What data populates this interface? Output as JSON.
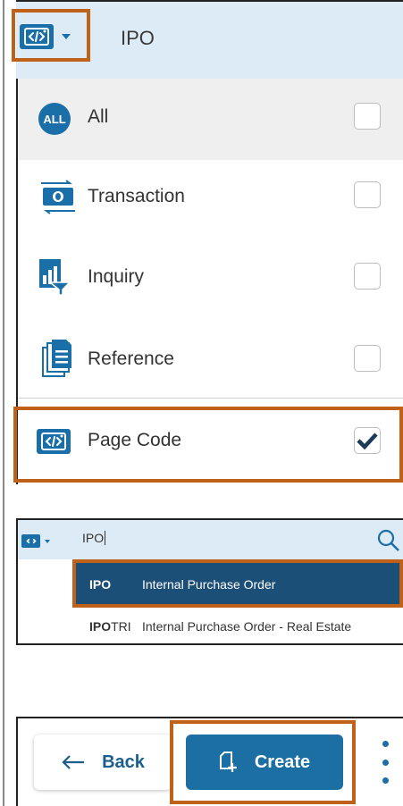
{
  "filter_panel": {
    "title": "IPO",
    "items": [
      {
        "label": "All",
        "checked": false
      },
      {
        "label": "Transaction",
        "checked": false
      },
      {
        "label": "Inquiry",
        "checked": false
      },
      {
        "label": "Reference",
        "checked": false
      },
      {
        "label": "Page Code",
        "checked": true
      }
    ],
    "all_badge_text": "ALL"
  },
  "search_panel": {
    "input_value": "IPO",
    "results": [
      {
        "code": "IPO",
        "code_bold": "IPO",
        "code_rest": "",
        "description": "Internal Purchase Order",
        "selected": true
      },
      {
        "code": "IPOTRI",
        "code_bold": "IPO",
        "code_rest": "TRI",
        "description": "Internal Purchase Order - Real Estate",
        "selected": false
      }
    ]
  },
  "actions": {
    "back_label": "Back",
    "create_label": "Create"
  },
  "colors": {
    "accent": "#1a6fa8",
    "highlight": "#c0611a",
    "header_bg": "#dcebf5",
    "selected_row": "#1c4f78"
  }
}
